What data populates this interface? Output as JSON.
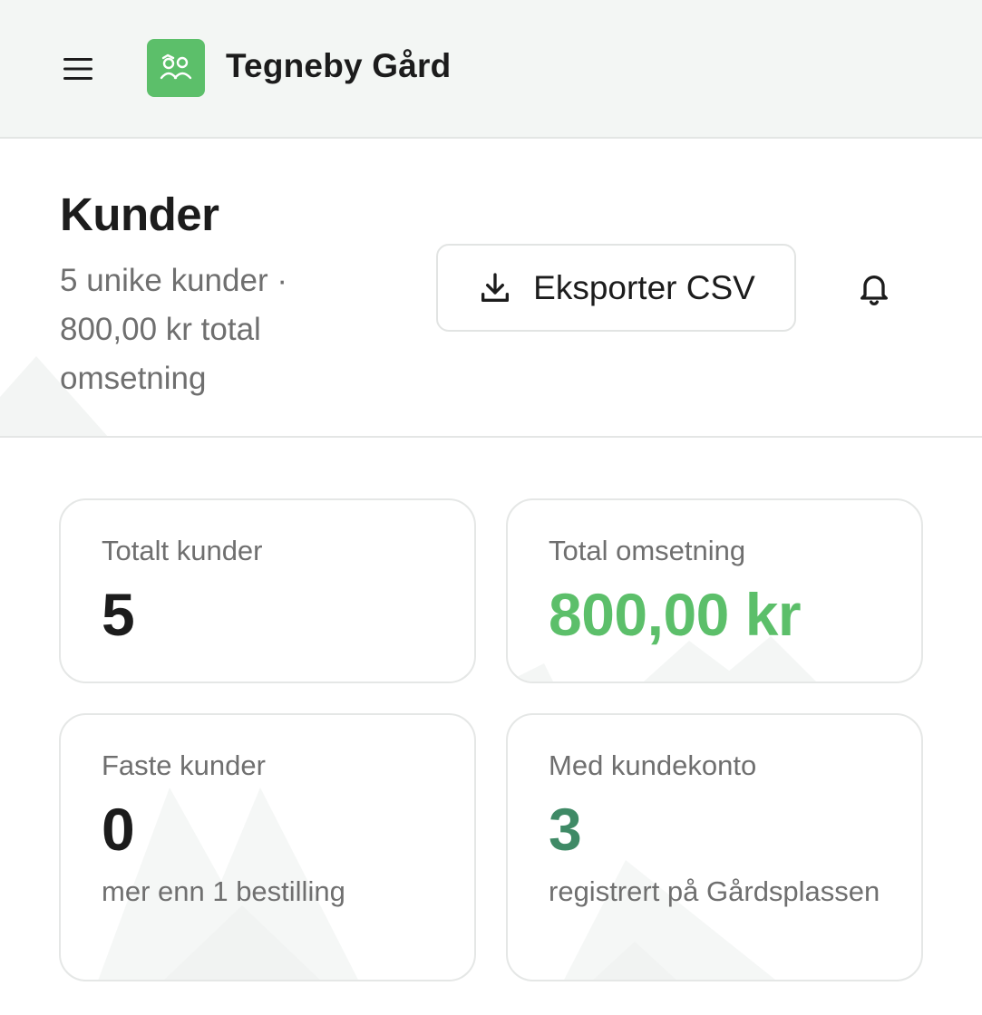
{
  "app": {
    "brand": "Tegneby Gård",
    "brand_color": "#5cbf6a"
  },
  "icons": {
    "menu": "menu-icon",
    "logo": "farm-logo-icon",
    "download": "download-icon",
    "bell": "bell-icon"
  },
  "header": {
    "title": "Kunder",
    "subtitle": "5 unike kunder · 800,00 kr total omsetning",
    "export_label": "Eksporter CSV"
  },
  "stats": {
    "total_customers": {
      "label": "Totalt kunder",
      "value": "5"
    },
    "total_revenue": {
      "label": "Total omsetning",
      "value": "800,00 kr",
      "color": "#5cbf6a"
    },
    "regular_customers": {
      "label": "Faste kunder",
      "value": "0",
      "note": "mer enn 1 bestilling"
    },
    "with_account": {
      "label": "Med kundekonto",
      "value": "3",
      "note": "registrert på Gårdsplassen",
      "color": "#3f8a66"
    }
  }
}
